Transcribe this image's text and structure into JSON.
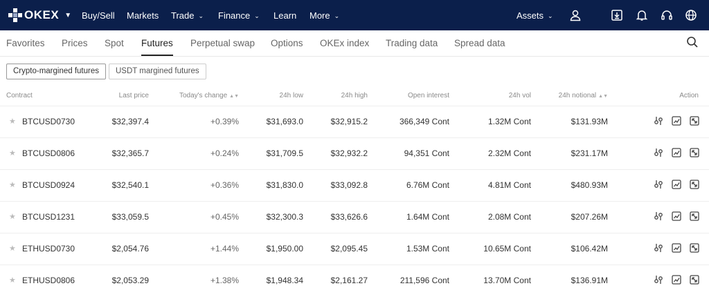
{
  "brand": {
    "name": "OKEX"
  },
  "topnav": {
    "items": [
      {
        "label": "Buy/Sell",
        "has_menu": false
      },
      {
        "label": "Markets",
        "has_menu": false
      },
      {
        "label": "Trade",
        "has_menu": true
      },
      {
        "label": "Finance",
        "has_menu": true
      },
      {
        "label": "Learn",
        "has_menu": false
      },
      {
        "label": "More",
        "has_menu": true
      }
    ],
    "assets_label": "Assets",
    "icons": [
      "user-icon",
      "download-icon",
      "bell-icon",
      "headset-icon",
      "globe-icon"
    ]
  },
  "tabs": [
    "Favorites",
    "Prices",
    "Spot",
    "Futures",
    "Perpetual swap",
    "Options",
    "OKEx index",
    "Trading data",
    "Spread data"
  ],
  "active_tab": "Futures",
  "filters": [
    "Crypto-margined futures",
    "USDT margined futures"
  ],
  "active_filter": "Crypto-margined futures",
  "table": {
    "headers": {
      "contract": "Contract",
      "last_price": "Last price",
      "change": "Today's change",
      "low": "24h low",
      "high": "24h high",
      "open_interest": "Open interest",
      "vol": "24h vol",
      "notional": "24h notional",
      "action": "Action"
    },
    "rows": [
      {
        "contract": "BTCUSD0730",
        "last_price": "$32,397.4",
        "change": "+0.39%",
        "low": "$31,693.0",
        "high": "$32,915.2",
        "open_interest": "366,349 Cont",
        "vol": "1.32M Cont",
        "notional": "$131.93M"
      },
      {
        "contract": "BTCUSD0806",
        "last_price": "$32,365.7",
        "change": "+0.24%",
        "low": "$31,709.5",
        "high": "$32,932.2",
        "open_interest": "94,351 Cont",
        "vol": "2.32M Cont",
        "notional": "$231.17M"
      },
      {
        "contract": "BTCUSD0924",
        "last_price": "$32,540.1",
        "change": "+0.36%",
        "low": "$31,830.0",
        "high": "$33,092.8",
        "open_interest": "6.76M Cont",
        "vol": "4.81M Cont",
        "notional": "$480.93M"
      },
      {
        "contract": "BTCUSD1231",
        "last_price": "$33,059.5",
        "change": "+0.45%",
        "low": "$32,300.3",
        "high": "$33,626.6",
        "open_interest": "1.64M Cont",
        "vol": "2.08M Cont",
        "notional": "$207.26M"
      },
      {
        "contract": "ETHUSD0730",
        "last_price": "$2,054.76",
        "change": "+1.44%",
        "low": "$1,950.00",
        "high": "$2,095.45",
        "open_interest": "1.53M Cont",
        "vol": "10.65M Cont",
        "notional": "$106.42M"
      },
      {
        "contract": "ETHUSD0806",
        "last_price": "$2,053.29",
        "change": "+1.38%",
        "low": "$1,948.34",
        "high": "$2,161.27",
        "open_interest": "211,596 Cont",
        "vol": "13.70M Cont",
        "notional": "$136.91M"
      }
    ],
    "row_actions": [
      "settings-icon",
      "chart-icon",
      "expand-icon"
    ]
  },
  "colors": {
    "nav_bg": "#0b1f4b",
    "text": "#333333",
    "muted": "#8a8a8a"
  }
}
